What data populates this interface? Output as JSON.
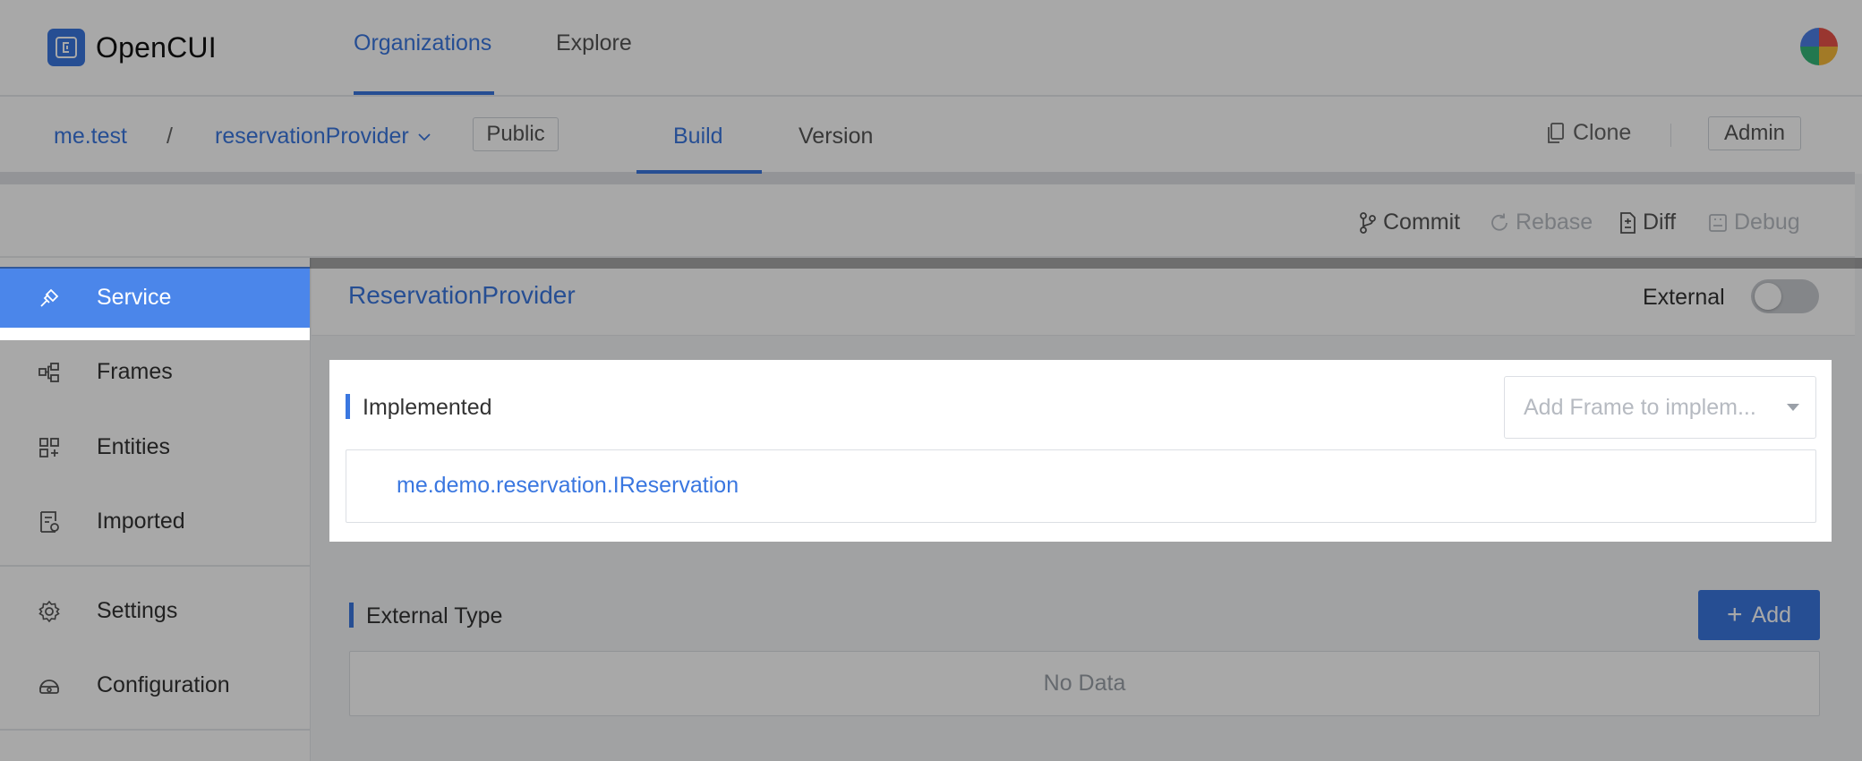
{
  "app": {
    "name": "OpenCUI"
  },
  "nav": {
    "tabs": [
      {
        "label": "Organizations"
      },
      {
        "label": "Explore"
      }
    ]
  },
  "breadcrumb": {
    "org": "me.test",
    "separator": "/",
    "project": "reservationProvider",
    "visibility": "Public"
  },
  "subtabs": [
    {
      "label": "Build"
    },
    {
      "label": "Version"
    }
  ],
  "actions": {
    "clone": "Clone",
    "admin": "Admin"
  },
  "toolbar": {
    "commit": "Commit",
    "rebase": "Rebase",
    "diff": "Diff",
    "debug": "Debug"
  },
  "sidebar": {
    "items": [
      {
        "label": "Service",
        "icon": "service-icon"
      },
      {
        "label": "Frames",
        "icon": "frames-icon"
      },
      {
        "label": "Entities",
        "icon": "entities-icon"
      },
      {
        "label": "Imported",
        "icon": "imported-icon"
      },
      {
        "label": "Settings",
        "icon": "gear-icon"
      },
      {
        "label": "Configuration",
        "icon": "configuration-icon"
      }
    ]
  },
  "content": {
    "title": "ReservationProvider",
    "external_label": "External",
    "external_on": false,
    "implemented": {
      "title": "Implemented",
      "select_placeholder": "Add Frame to implem...",
      "items": [
        "me.demo.reservation.IReservation"
      ]
    },
    "external_type": {
      "title": "External Type",
      "add_label": "Add",
      "empty_text": "No Data"
    }
  },
  "colors": {
    "accent": "#3a77e0",
    "sidebar_active": "#4b86ea"
  }
}
